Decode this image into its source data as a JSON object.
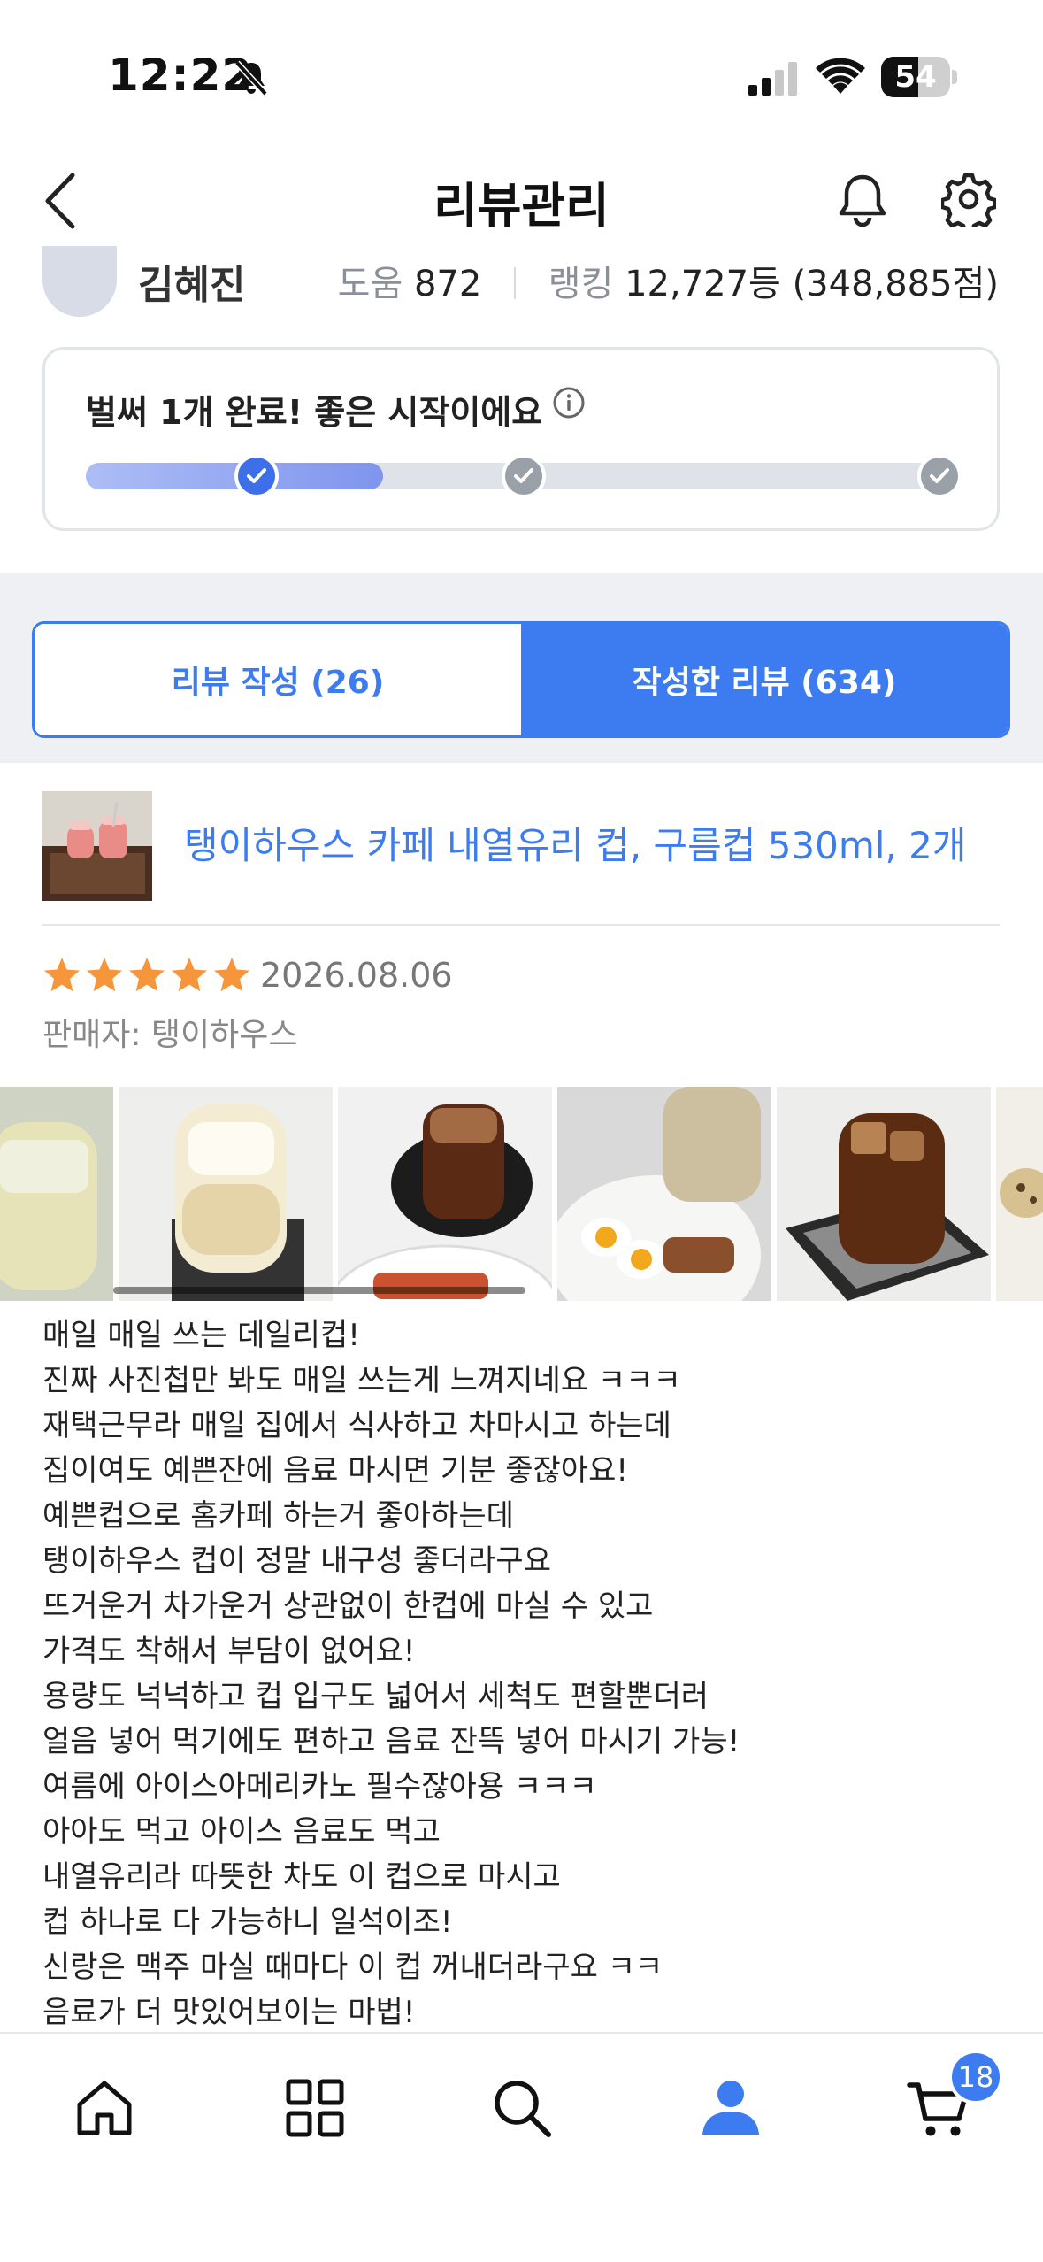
{
  "status_bar": {
    "time": "12:22",
    "battery_level": "54",
    "battery_fraction": 0.54
  },
  "header": {
    "title": "리뷰관리"
  },
  "profile": {
    "name": "김혜진",
    "help_label": "도움",
    "help_count": "872",
    "rank_label": "랭킹",
    "rank_value": "12,727등 (348,885점)"
  },
  "progress": {
    "title": "벌써 1개 완료! 좋은 시작이에요",
    "completed_steps": 1,
    "total_steps": 3,
    "fill_fraction": 0.34,
    "active_color": "#3d6fe8",
    "inactive_color": "#9aa0a8"
  },
  "tabs": [
    {
      "label": "리뷰 작성 (26)",
      "active": false
    },
    {
      "label": "작성한 리뷰 (634)",
      "active": true
    }
  ],
  "product": {
    "title": "탱이하우스 카페 내열유리 컵, 구름컵 530ml, 2개"
  },
  "review": {
    "rating": 5,
    "date": "2026.08.06",
    "seller_label": "판매자: 탱이하우스",
    "photos": [
      "iced-drink",
      "latte-glass",
      "cold-brew-on-plate",
      "coffee-and-eggs",
      "iced-americano-coaster",
      "cookie"
    ],
    "lines": [
      "매일 매일 쓰는 데일리컵!",
      "진짜 사진첩만 봐도 매일 쓰는게 느껴지네요 ㅋㅋㅋ",
      "재택근무라 매일 집에서 식사하고 차마시고 하는데",
      "집이여도 예쁜잔에 음료 마시면 기분 좋잖아요!",
      "예쁜컵으로 홈카페 하는거 좋아하는데",
      "탱이하우스 컵이 정말 내구성 좋더라구요",
      "뜨거운거 차가운거 상관없이 한컵에 마실 수 있고",
      "가격도 착해서 부담이 없어요!",
      "용량도 넉넉하고 컵 입구도 넓어서 세척도 편할뿐더러",
      "얼음 넣어 먹기에도 편하고 음료 잔뜩 넣어 마시기 가능!",
      "여름에 아이스아메리카노 필수잖아용 ㅋㅋㅋ",
      "아아도 먹고 아이스 음료도 먹고",
      "내열유리라 따뜻한 차도 이 컵으로 마시고",
      "컵 하나로 다 가능하니 일석이조!",
      "신랑은 맥주 마실 때마다 이 컵 꺼내더라구요 ㅋㅋ",
      "음료가 더 맛있어보이는 마법!"
    ]
  },
  "bottom_nav": {
    "items": [
      "home-icon",
      "categories-icon",
      "search-icon",
      "my-page-icon",
      "cart-icon"
    ],
    "cart_count": "18",
    "active_color": "#3d7cf0"
  }
}
